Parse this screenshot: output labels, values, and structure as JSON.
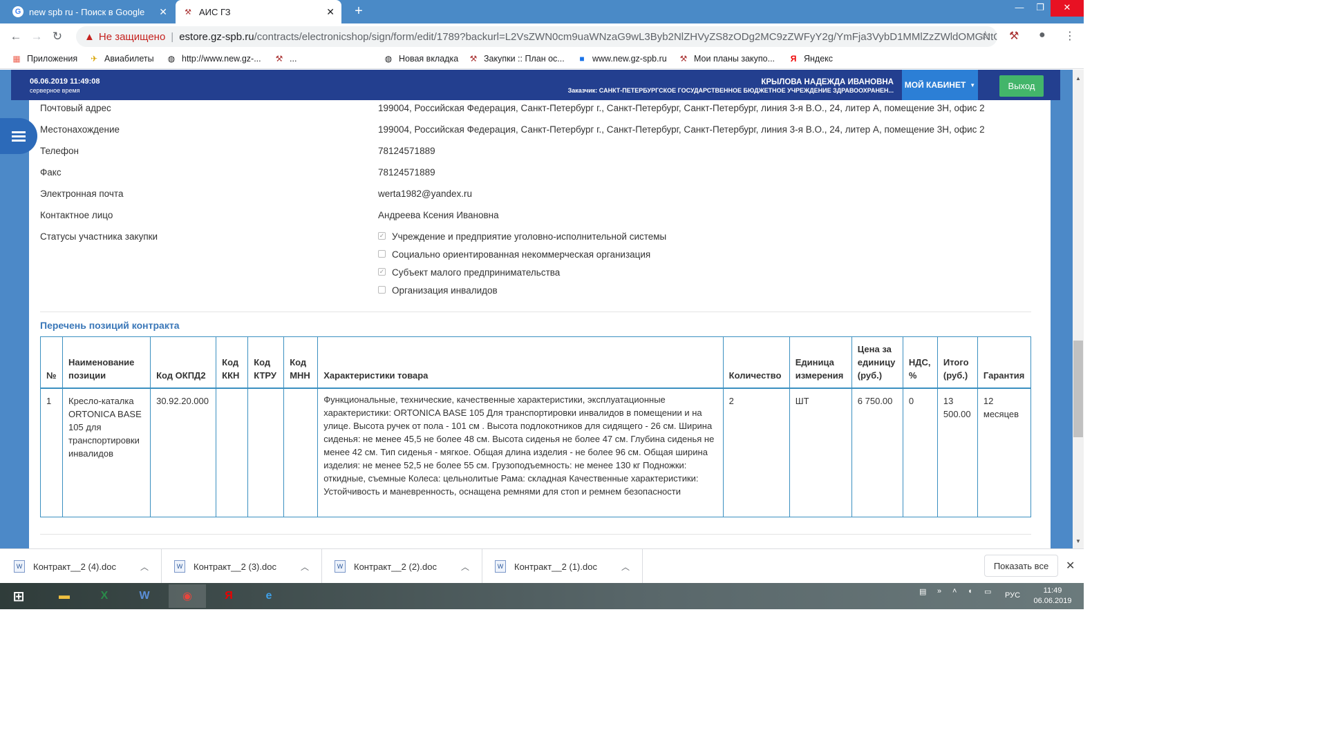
{
  "browser": {
    "tabs": [
      {
        "title": "new spb ru - Поиск в Google"
      },
      {
        "title": "АИС ГЗ"
      }
    ],
    "new_tab": "+",
    "window": {
      "minimize": "—",
      "maximize": "❐",
      "close": "✕"
    },
    "address": {
      "security_label": "Не защищено",
      "host": "estore.gz-spb.ru",
      "path": "/contracts/electronicshop/sign/form/edit/1789?backurl=L2VsZWN0cm9uaWNzaG9wL3Byb2NlZHVyZS8zODg2MC9zZWFyY2g/YmFja3VybD1MMlZzZWldOMGNtOXVh..."
    },
    "bookmarks": [
      {
        "label": "Приложения",
        "icon": "apps-grid-icon"
      },
      {
        "label": "Авиабилеты",
        "icon": "airplane-icon"
      },
      {
        "label": "http://www.new.gz-...",
        "icon": "globe-icon"
      },
      {
        "label": "...",
        "icon": "gz-logo-icon"
      },
      {
        "label": "Новая вкладка",
        "icon": "globe-icon"
      },
      {
        "label": "Закупки :: План ос...",
        "icon": "gz-logo-icon"
      },
      {
        "label": "www.new.gz-spb.ru",
        "icon": "folder-icon"
      },
      {
        "label": "Мои планы закупо...",
        "icon": "gz-logo-icon"
      },
      {
        "label": "Яндекс",
        "icon": "yandex-icon"
      }
    ]
  },
  "header": {
    "datetime": "06.06.2019 11:49:08",
    "timezone": "серверное время",
    "user_name": "КРЫЛОВА НАДЕЖДА ИВАНОВНА",
    "customer": "Заказчик: САНКТ-ПЕТЕРБУРГСКОЕ ГОСУДАРСТВЕННОЕ БЮДЖЕТНОЕ УЧРЕЖДЕНИЕ ЗДРАВООХРАНЕН...",
    "cabinet_label": "МОЙ КАБИНЕТ",
    "logout_label": "Выход",
    "accent": "#233f8f"
  },
  "supplier": {
    "fields": [
      {
        "label": "Почтовый адрес",
        "value": "199004, Российская Федерация, Санкт-Петербург г., Санкт-Петербург, Санкт-Петербург, линия 3-я В.О., 24, литер А, помещение 3Н, офис 2"
      },
      {
        "label": "Местонахождение",
        "value": "199004, Российская Федерация, Санкт-Петербург г., Санкт-Петербург, Санкт-Петербург, линия 3-я В.О., 24, литер А, помещение 3Н, офис 2"
      },
      {
        "label": "Телефон",
        "value": "78124571889"
      },
      {
        "label": "Факс",
        "value": "78124571889"
      },
      {
        "label": "Электронная почта",
        "value": "werta1982@yandex.ru"
      },
      {
        "label": "Контактное лицо",
        "value": "Андреева Ксения Ивановна"
      }
    ],
    "statuses_label": "Статусы участника закупки",
    "statuses": [
      {
        "label": "Учреждение и предприятие уголовно-исполнительной системы",
        "checked": true
      },
      {
        "label": "Социально ориентированная некоммерческая организация",
        "checked": false
      },
      {
        "label": "Субъект малого предпринимательства",
        "checked": true
      },
      {
        "label": "Организация инвалидов",
        "checked": false
      }
    ]
  },
  "positions": {
    "title": "Перечень позиций контракта",
    "columns": [
      "№",
      "Наименование позиции",
      "Код ОКПД2",
      "Код ККН",
      "Код КТРУ",
      "Код МНН",
      "Характеристики товара",
      "Количество",
      "Единица измерения",
      "Цена за единицу (руб.)",
      "НДС, %",
      "Итого (руб.)",
      "Гарантия"
    ],
    "rows": [
      [
        "1",
        "Кресло-каталка ORTONICA BASE 105 для транспортировки инвалидов",
        "30.92.20.000",
        "",
        "",
        "",
        "Функциональные, технические, качественные характеристики, эксплуатационные характеристики: ORTONICA BASE 105 Для транспортировки инвалидов в помещении и на улице. Высота ручек от пола - 101 см . Высота подлокотников для сидящего - 26 см. Ширина сиденья: не менее 45,5 не более 48 см. Высота сиденья не более 47 см. Глубина сиденья не менее 42 см. Тип сиденья - мягкое. Общая длина изделия - не более 96 см. Общая ширина изделия: не менее 52,5 не более 55 см. Грузоподъемность: не менее 130 кг Подножки: откидные, съемные Колеса: цельнолитые Рама: складная Качественные характеристики: Устойчивость и маневренность, оснащена ремнями для стоп и ремнем безопасности",
        "2",
        "ШТ",
        "6 750.00",
        "0",
        "13 500.00",
        "12 месяцев"
      ]
    ]
  },
  "downloads": {
    "items": [
      "Контракт__2 (4).doc",
      "Контракт__2 (3).doc",
      "Контракт__2 (2).doc",
      "Контракт__2 (1).doc"
    ],
    "show_all": "Показать все"
  },
  "taskbar": {
    "lang": "РУС",
    "time": "11:49",
    "date": "06.06.2019"
  }
}
